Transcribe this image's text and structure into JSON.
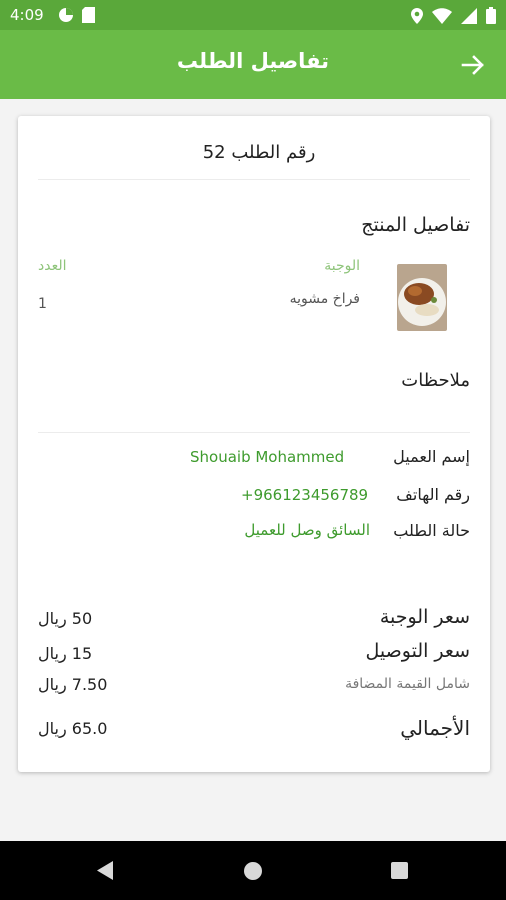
{
  "status_bar": {
    "time": "4:09"
  },
  "header": {
    "title": "تفاصيل الطلب",
    "back_icon": "arrow-right-icon"
  },
  "order": {
    "label": "رقم الطلب",
    "number": "52"
  },
  "product_section": {
    "title": "تفاصيل المنتج",
    "meal_header": "الوجبة",
    "qty_header": "العدد",
    "item_name": "فراخ مشويه",
    "item_qty": "1"
  },
  "notes": {
    "title": "ملاحظات"
  },
  "customer": {
    "name_label": "إسم العميل",
    "name_value": "Shouaib Mohammed",
    "phone_label": "رقم الهاتف",
    "phone_value": "+966123456789",
    "status_label": "حالة الطلب",
    "status_value": "السائق وصل للعميل"
  },
  "pricing": {
    "meal_label": "سعر الوجبة",
    "meal_value": "50 ريال",
    "delivery_label": "سعر التوصيل",
    "delivery_value": "15 ريال",
    "vat_label": "شامل القيمة المضافة",
    "vat_value": "7.50 ريال",
    "total_label": "الأجمالي",
    "total_value": "65.0 ريال"
  },
  "colors": {
    "primary": "#6abb47",
    "status_bar": "#5aa83a",
    "accent_text": "#3e9b2d"
  }
}
